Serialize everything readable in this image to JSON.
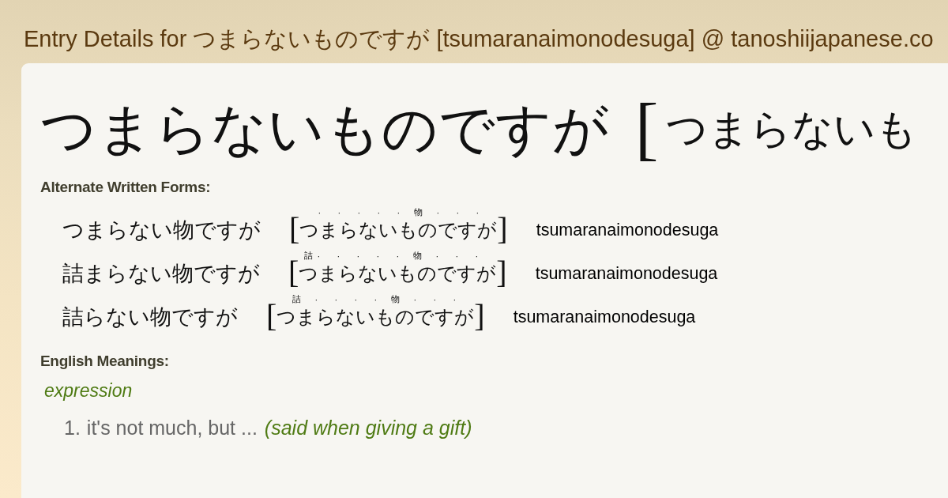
{
  "page_title": "Entry Details for つまらないものですが [tsumaranaimonodesuga] @ tanoshiijapanese.co",
  "entry": {
    "word": "つまらないものですが",
    "open_bracket": "[",
    "reading": "つまらないも"
  },
  "alternate_forms": {
    "heading": "Alternate Written Forms:",
    "rows": [
      {
        "written": "つまらない物ですが",
        "open_bracket": "[",
        "segments": [
          {
            "kana": "つ"
          },
          {
            "kana": "ま"
          },
          {
            "kana": "ら"
          },
          {
            "kana": "な"
          },
          {
            "kana": "い"
          },
          {
            "kana": "もの",
            "ruby": "物"
          },
          {
            "kana": "で"
          },
          {
            "kana": "す"
          },
          {
            "kana": "が"
          }
        ],
        "separator": "·",
        "close_bracket": "]",
        "romaji": "tsumaranaimonodesuga"
      },
      {
        "written": "詰まらない物ですが",
        "open_bracket": "[",
        "segments": [
          {
            "kana": "つ",
            "ruby": "詰"
          },
          {
            "kana": "ま"
          },
          {
            "kana": "ら"
          },
          {
            "kana": "な"
          },
          {
            "kana": "い"
          },
          {
            "kana": "もの",
            "ruby": "物"
          },
          {
            "kana": "で"
          },
          {
            "kana": "す"
          },
          {
            "kana": "が"
          }
        ],
        "separator": "·",
        "close_bracket": "]",
        "romaji": "tsumaranaimonodesuga"
      },
      {
        "written": "詰らない物ですが",
        "open_bracket": "[",
        "segments": [
          {
            "kana": "つま",
            "ruby": "詰"
          },
          {
            "kana": "ら"
          },
          {
            "kana": "な"
          },
          {
            "kana": "い"
          },
          {
            "kana": "もの",
            "ruby": "物"
          },
          {
            "kana": "で"
          },
          {
            "kana": "す"
          },
          {
            "kana": "が"
          }
        ],
        "separator": "·",
        "close_bracket": "]",
        "romaji": "tsumaranaimonodesuga"
      }
    ]
  },
  "english_meanings": {
    "heading": "English Meanings:",
    "groups": [
      {
        "part_of_speech": "expression",
        "senses": [
          {
            "number": "1.",
            "gloss": "it's not much, but ...",
            "note": "(said when giving a gift)"
          }
        ]
      }
    ]
  }
}
